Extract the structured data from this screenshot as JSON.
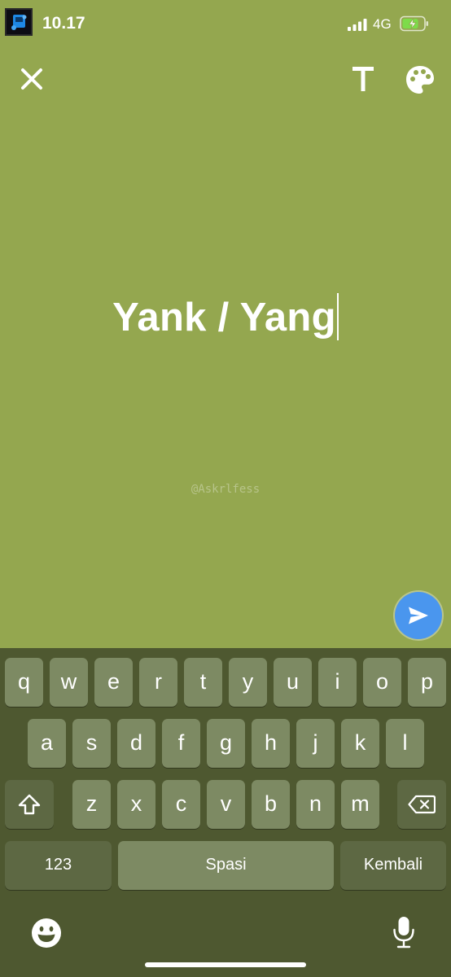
{
  "status_bar": {
    "time": "10.17",
    "network": "4G",
    "app_icon": "app-thumbnail-icon",
    "signal_icon": "cellular-signal-icon",
    "battery_icon": "battery-charging-icon"
  },
  "toolbar": {
    "close_icon": "close-icon",
    "text_style_label": "T",
    "palette_icon": "palette-icon"
  },
  "editor": {
    "text": "Yank / Yang",
    "watermark": "@Askrlfess"
  },
  "send_button": {
    "icon": "send-icon"
  },
  "keyboard": {
    "row1": [
      "q",
      "w",
      "e",
      "r",
      "t",
      "y",
      "u",
      "i",
      "o",
      "p"
    ],
    "row2": [
      "a",
      "s",
      "d",
      "f",
      "g",
      "h",
      "j",
      "k",
      "l"
    ],
    "row3": [
      "z",
      "x",
      "c",
      "v",
      "b",
      "n",
      "m"
    ],
    "shift_icon": "shift-icon",
    "backspace_icon": "backspace-icon",
    "numbers_label": "123",
    "space_label": "Spasi",
    "return_label": "Kembali",
    "emoji_icon": "emoji-icon",
    "mic_icon": "microphone-icon"
  },
  "colors": {
    "background": "#94a74f",
    "keyboard_background": "#4e5830",
    "key": "#7d8a63",
    "key_dark": "#5d6843",
    "send_button": "#4a96ee",
    "battery_charge": "#7ddc4a"
  }
}
